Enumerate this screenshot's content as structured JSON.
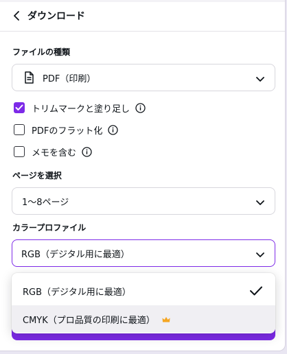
{
  "header": {
    "title": "ダウンロード",
    "back_icon": "chevron-left-icon"
  },
  "file_type": {
    "label": "ファイルの種類",
    "value": "PDF（印刷）",
    "icon": "document-icon"
  },
  "options": [
    {
      "label": "トリムマークと塗り足し",
      "checked": true
    },
    {
      "label": "PDFのフラット化",
      "checked": false
    },
    {
      "label": "メモを含む",
      "checked": false
    }
  ],
  "pages": {
    "label": "ページを選択",
    "value": "1〜8ページ"
  },
  "color_profile": {
    "label": "カラープロファイル",
    "value": "RGB（デジタル用に最適）",
    "menu": [
      {
        "label": "RGB（デジタル用に最適）",
        "selected": true,
        "premium": false
      },
      {
        "label": "CMYK（プロ品質の印刷に最適）",
        "selected": false,
        "premium": true
      }
    ]
  },
  "colors": {
    "accent": "#7d2ae8",
    "crown": "#f5a623"
  }
}
